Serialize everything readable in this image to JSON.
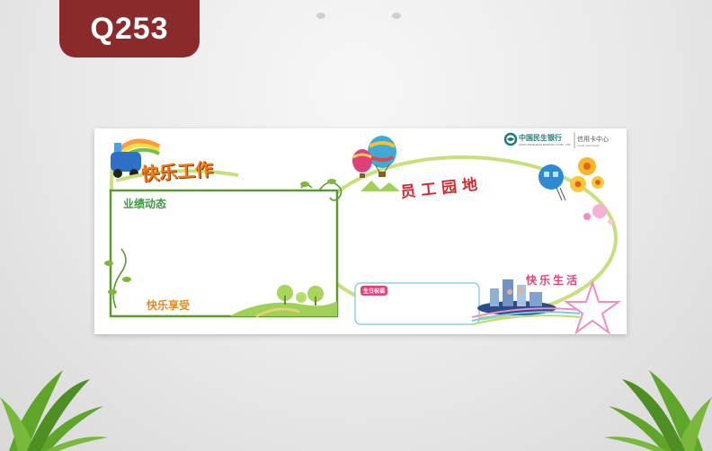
{
  "product_code": "Q253",
  "board": {
    "left_panel": {
      "title": "快乐工作",
      "section_top": "业绩动态",
      "section_bottom": "快乐享受"
    },
    "center_panel": {
      "title": "员工园地",
      "birthday_label": "生日祝福"
    },
    "right_panel": {
      "bank_name": "中国民生银行",
      "bank_name_en": "CHINA MINSHENG BANKING CORP., LTD.",
      "department": "信用卡中心",
      "department_en": "Credit Card Center",
      "section_title": "快乐生活"
    }
  },
  "colors": {
    "badge": "#8b2a2a",
    "frame_green": "#5c9a2c",
    "oval_green": "#c8e07a",
    "pink": "#f08cc0",
    "title_orange": "#f07b18",
    "title_red": "#d8282e"
  }
}
